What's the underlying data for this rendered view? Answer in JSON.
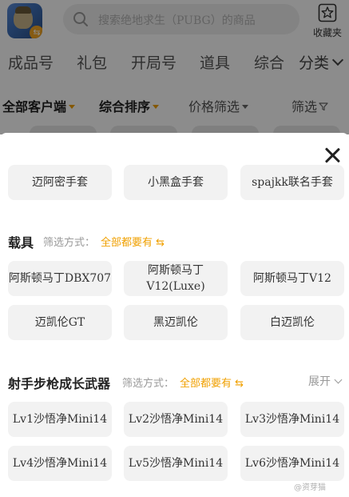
{
  "header": {
    "search_placeholder": "搜索绝地求生（PUBG）的商品",
    "favorite_label": "收藏夹",
    "game_badge": "⇆"
  },
  "category_tabs": [
    "成品号",
    "礼包",
    "开局号",
    "道具",
    "综合"
  ],
  "category_more": "分类",
  "filter_bar": {
    "client": "全部客户端",
    "sort": "综合排序",
    "price": "价格筛选",
    "filter": "筛选"
  },
  "sheet": {
    "top_options": [
      "迈阿密手套",
      "小黑盒手套",
      "spajkk联名手套"
    ],
    "sections": [
      {
        "title": "载具",
        "mode_label": "筛选方式：",
        "mode_value": "全部都要有 ⇆",
        "options": [
          "阿斯顿马丁DBX707",
          "阿斯顿马丁V12(Luxe)",
          "阿斯顿马丁V12",
          "迈凯伦GT",
          "黑迈凯伦",
          "白迈凯伦"
        ]
      },
      {
        "title": "射手步枪成长武器",
        "mode_label": "筛选方式：",
        "mode_value": "全部都要有 ⇆",
        "expand": "展开",
        "options": [
          "Lv1沙悟净Mini14",
          "Lv2沙悟净Mini14",
          "Lv3沙悟净Mini14",
          "Lv4沙悟净Mini14",
          "Lv5沙悟净Mini14",
          "Lv6沙悟净Mini14"
        ]
      }
    ]
  },
  "watermark": "@资芽猫",
  "colors": {
    "accent": "#f0a000",
    "option_bg": "#f2f2f2",
    "overlay": "rgba(0,0,0,0.45)"
  }
}
